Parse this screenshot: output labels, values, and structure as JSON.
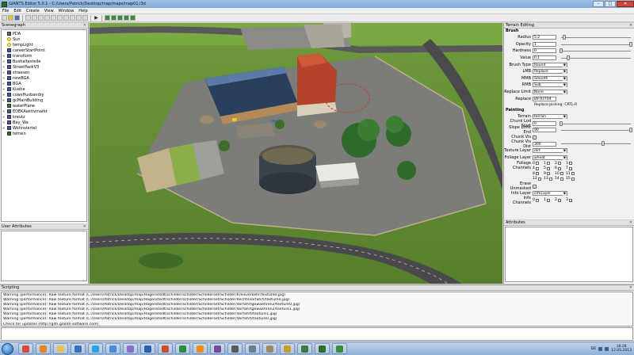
{
  "window": {
    "title": "GIANTS Editor 5.0.1 - C:/Users/Patrick/Desktop/map/maps/map01.i3d",
    "minimize": "–",
    "maximize": "□",
    "close": "✕"
  },
  "menu": [
    "File",
    "Edit",
    "Create",
    "View",
    "Window",
    "Help"
  ],
  "scenegraph": {
    "title": "Scenegraph",
    "items": [
      {
        "label": "PDA",
        "icon": "camera-icon",
        "expander": false
      },
      {
        "label": "Sun",
        "icon": "light-icon",
        "expander": false
      },
      {
        "label": "tempLight",
        "icon": "light-icon",
        "expander": false
      },
      {
        "label": "careerStartPoint",
        "icon": "transform-icon",
        "expander": false
      },
      {
        "label": "transform",
        "icon": "transform-icon",
        "expander": true
      },
      {
        "label": "Bushaltestelle",
        "icon": "transform-icon",
        "expander": true
      },
      {
        "label": "StreetPackV3",
        "icon": "transform-icon",
        "expander": true
      },
      {
        "label": "strassen",
        "icon": "transform-icon",
        "expander": true
      },
      {
        "label": "newBGA",
        "icon": "transform-icon",
        "expander": true
      },
      {
        "label": "BGA",
        "icon": "transform-icon",
        "expander": true
      },
      {
        "label": "Kuehe",
        "icon": "transform-icon",
        "expander": true
      },
      {
        "label": "cowsHusbandry",
        "icon": "transform-icon",
        "expander": true
      },
      {
        "label": "gcMainBuilding",
        "icon": "transform-icon",
        "expander": true
      },
      {
        "label": "waterPlane",
        "icon": "shape-icon",
        "expander": false
      },
      {
        "label": "EDEKAaktivmarkt",
        "icon": "transform-icon",
        "expander": true
      },
      {
        "label": "kreutz",
        "icon": "transform-icon",
        "expander": true
      },
      {
        "label": "Bay_Wa",
        "icon": "transform-icon",
        "expander": true
      },
      {
        "label": "Wohnviertel",
        "icon": "transform-icon",
        "expander": true
      },
      {
        "label": "terrain",
        "icon": "terrain-icon",
        "expander": false
      }
    ]
  },
  "user_attributes": {
    "title": "User Attributes"
  },
  "terrain_editing": {
    "title": "Terrain Editing",
    "brush_label": "Brush",
    "radius": {
      "label": "Radius",
      "value": "5.2",
      "level": 0.05
    },
    "opacity": {
      "label": "Opacity",
      "value": "1",
      "level": 1.0
    },
    "hardness": {
      "label": "Hardness",
      "value": "0",
      "level": 0.0
    },
    "value": {
      "label": "Value",
      "value": "0.1",
      "level": 0.1
    },
    "brush_type": {
      "label": "Brush Type",
      "value": "Round"
    },
    "lmb": {
      "label": "LMB",
      "value": "Replace"
    },
    "mmb": {
      "label": "MMB",
      "value": "Smooth"
    },
    "rmb": {
      "label": "RMB",
      "value": "Sub"
    },
    "replace_limit": {
      "label": "Replace Limit",
      "value": "None"
    },
    "replace": {
      "label": "Replace",
      "value": "89.93704"
    },
    "replace_picking": "Replace picking: CRTL-R",
    "painting_label": "Painting",
    "terrain": {
      "label": "Terrain",
      "value": "terrain"
    },
    "chunk_lod_start": {
      "label": "Chunk Lod Start",
      "value": "0",
      "level": 0.0
    },
    "chunk_lod_end": {
      "label": "Slope Limit End",
      "value": "90",
      "level": 1.0
    },
    "chunk_vis": {
      "label": "Chunk Vis",
      "checked": "✓"
    },
    "chunk_vis_dist": {
      "label": "Chunk Vis Dist",
      "value": "300",
      "level": 0.6
    },
    "texture_layer": {
      "label": "Texture Layer",
      "value": "dirt"
    },
    "foliage_layer": {
      "label": "Foliage Layer",
      "value": "wheat"
    },
    "foliage_channels": {
      "label": "Foliage Channels",
      "numbers": [
        "0",
        "1",
        "2",
        "3",
        "4",
        "5",
        "6",
        "7",
        "8",
        "9",
        "10",
        "11",
        "12",
        "13",
        "14",
        "15"
      ]
    },
    "erase_unmasked": {
      "label": "Erase Unmasked",
      "checked": "✓"
    },
    "info_layer": {
      "label": "Info Layer",
      "value": "infoLayer"
    },
    "info_channels": {
      "label": "Info Channels",
      "numbers": [
        "0",
        "1",
        "2",
        "3"
      ]
    }
  },
  "attributes": {
    "title": "Attributes"
  },
  "scripting": {
    "title": "Scripting",
    "log": [
      "Warning (performance): Raw texture format (C:/Users/Patrick/Desktop/map/Hagenstedt/schilder/schilder/Schilderset/Schilder/Kreisverkehr/texture0.jpg)",
      "Warning (performance): Raw texture format (C:/Users/Patrick/Desktop/map/Hagenstedt/schilder/schilder/Schilderset/Schilder/Rechtsvorfahrt/texture0.jpg)",
      "Warning (performance): Raw texture format (C:/Users/Patrick/Desktop/map/Hagenstedt/schilder/schilder/Schilderset/Schilder/Vorfahrtgewaehren2/texture0.jpg)",
      "Warning (performance): Raw texture format (C:/Users/Patrick/Desktop/map/Hagenstedt/schilder/schilder/Schilderset/Schilder/Vorfahrtgewaehren2/texture1.jpg)",
      "Warning (performance): Raw texture format (C:/Users/Patrick/Desktop/map/Hagenstedt/schilder/schilder/Schilderset/Schilder/Vorfahrt/texture1.jpg)",
      "Warning (performance): Raw texture format (C:/Users/Patrick/Desktop/map/Hagenstedt/schilder/schilder/Schilderset/Schilder/Vorfahrt/texture0.jpg)",
      "Check for updates (http://gdn.giants-software.com)"
    ]
  },
  "taskbar": {
    "apps": [
      {
        "name": "chrome-icon",
        "color": "#d64a3a"
      },
      {
        "name": "firefox-icon",
        "color": "#e8832a"
      },
      {
        "name": "explorer-icon",
        "color": "#e7c15a"
      },
      {
        "name": "media-player-icon",
        "color": "#3b6fc2"
      },
      {
        "name": "skype-icon",
        "color": "#2aa6e8"
      },
      {
        "name": "mail-icon",
        "color": "#4a8ad6"
      },
      {
        "name": "photos-icon",
        "color": "#8a6fc9"
      },
      {
        "name": "word-icon",
        "color": "#2b5fb0"
      },
      {
        "name": "powerpoint-icon",
        "color": "#c9502e"
      },
      {
        "name": "excel-icon",
        "color": "#2f8a43"
      },
      {
        "name": "vlc-icon",
        "color": "#f08a1a"
      },
      {
        "name": "winrar-icon",
        "color": "#7a4a9a"
      },
      {
        "name": "audio-icon",
        "color": "#5a5a5a"
      },
      {
        "name": "settings-icon",
        "color": "#6b7d8f"
      },
      {
        "name": "tools-icon",
        "color": "#9a8a6a"
      },
      {
        "name": "game-icon",
        "color": "#c8a02a"
      },
      {
        "name": "farming-icon",
        "color": "#3a7a3a"
      },
      {
        "name": "tractor-icon",
        "color": "#2f6a2f"
      },
      {
        "name": "giants-editor-icon",
        "color": "#3e8a3e"
      }
    ],
    "language": "DE",
    "time": "18:28",
    "date": "12.05.2013"
  }
}
